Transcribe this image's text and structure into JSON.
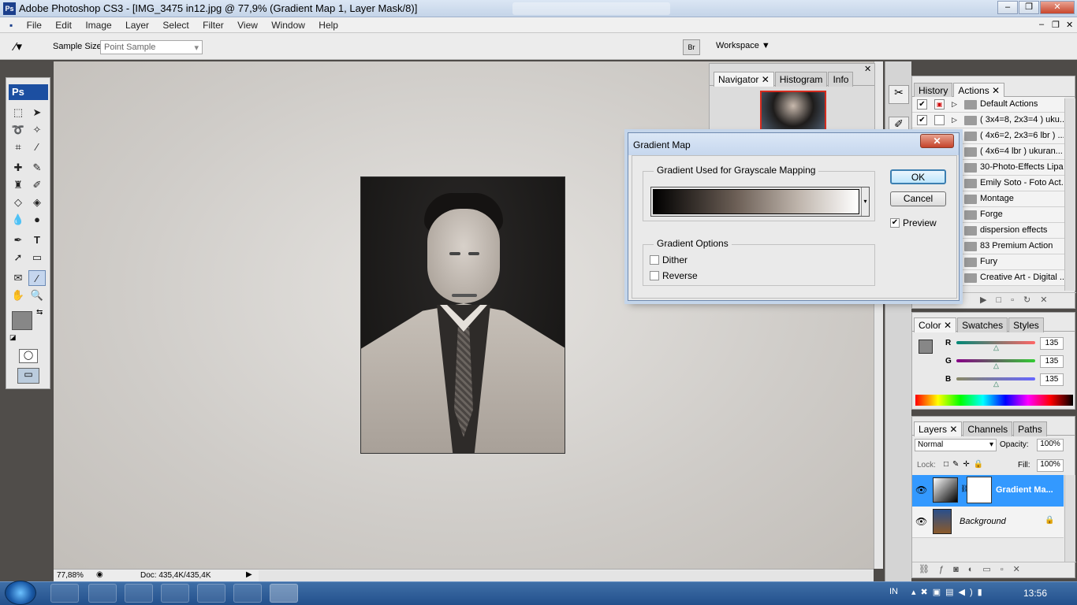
{
  "window": {
    "title": "Adobe Photoshop CS3 - [IMG_3475 in12.jpg @ 77,9% (Gradient Map 1, Layer Mask/8)]"
  },
  "menu": [
    "File",
    "Edit",
    "Image",
    "Layer",
    "Select",
    "Filter",
    "View",
    "Window",
    "Help"
  ],
  "options": {
    "sample_size_label": "Sample Size:",
    "sample_size_value": "Point Sample",
    "workspace_label": "Workspace ▼"
  },
  "status": {
    "zoom": "77,88%",
    "doc": "Doc: 435,4K/435,4K"
  },
  "navigator": {
    "tabs": [
      "Navigator",
      "Histogram",
      "Info"
    ]
  },
  "actions": {
    "tabs": [
      "History",
      "Actions"
    ],
    "items": [
      "Default Actions",
      "( 3x4=8, 2x3=4 ) uku...",
      "( 4x6=2, 2x3=6 lbr ) ...",
      "( 4x6=4 lbr ) ukuran...",
      "30-Photo-Effects Lipa...",
      "Emily Soto - Foto Act...",
      "Montage",
      "Forge",
      "dispersion effects",
      "83 Premium Action",
      "Fury",
      "Creative Art - Digital ..."
    ]
  },
  "color": {
    "tabs": [
      "Color",
      "Swatches",
      "Styles"
    ],
    "channels": [
      {
        "label": "R",
        "value": "135"
      },
      {
        "label": "G",
        "value": "135"
      },
      {
        "label": "B",
        "value": "135"
      }
    ]
  },
  "layers": {
    "tabs": [
      "Layers",
      "Channels",
      "Paths"
    ],
    "blend_mode": "Normal",
    "opacity_label": "Opacity:",
    "opacity": "100%",
    "lock_label": "Lock:",
    "fill_label": "Fill:",
    "fill": "100%",
    "items": [
      {
        "name": "Gradient Ma..."
      },
      {
        "name": "Background"
      }
    ]
  },
  "dialog": {
    "title": "Gradient Map",
    "group1": "Gradient Used for Grayscale Mapping",
    "group2": "Gradient Options",
    "dither": "Dither",
    "reverse": "Reverse",
    "ok": "OK",
    "cancel": "Cancel",
    "preview": "Preview",
    "preview_checked": true
  },
  "tray": {
    "lang": "IN",
    "time": "13:56"
  },
  "colors": {
    "accent": "#3399ff",
    "foreground": "#878787"
  }
}
